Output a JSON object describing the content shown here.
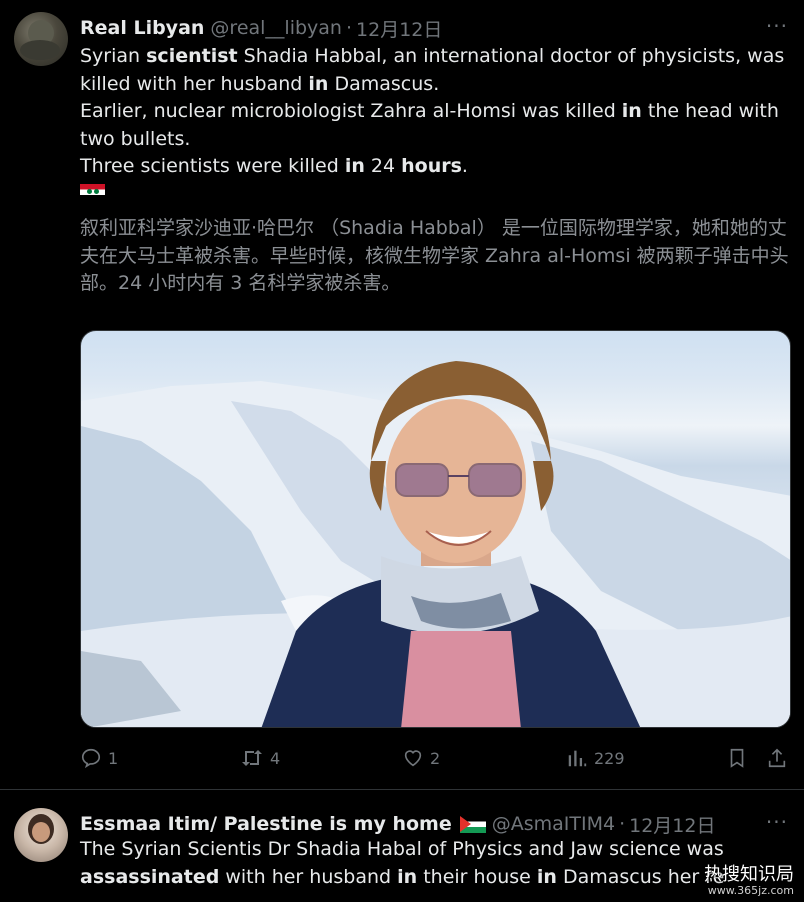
{
  "tweets": [
    {
      "name": "Real Libyan",
      "handle": "@real__libyan",
      "separator": "·",
      "date": "12月12日",
      "more": "···",
      "body_line1_parts": [
        "Syrian ",
        "scientist",
        " Shadia Habbal, an international doctor of physicists, was killed with her husband ",
        "in",
        " Damascus."
      ],
      "body_line2_parts": [
        "Earlier, nuclear microbiologist Zahra al-Homsi was killed ",
        "in",
        " the head with two bullets."
      ],
      "body_line3_parts": [
        "Three scientists were killed ",
        "in",
        " 24 ",
        "hours",
        "."
      ],
      "translation": "叙利亚科学家沙迪亚·哈巴尔 （Shadia Habbal） 是一位国际物理学家，她和她的丈夫在大马士革被杀害。早些时候，核微生物学家 Zahra al-Homsi 被两颗子弹击中头部。24 小时内有 3 名科学家被杀害。",
      "flag_icon": "syria-flag-icon",
      "actions": {
        "replies": "1",
        "retweets": "4",
        "likes": "2",
        "views": "229"
      }
    },
    {
      "name": "Essmaa Itim/ Palestine is my home",
      "flag_icon": "palestine-flag-icon",
      "handle": "@AsmaITIM4",
      "separator": "·",
      "date": "12月12日",
      "more": "···",
      "body_line1": "The Syrian Scientis Dr Shadia Habal  of Physics and Jaw science was",
      "body_line2_parts": [
        "assassinated",
        " with her husband ",
        "in",
        " their house ",
        "in",
        " Damascus her re"
      ]
    }
  ],
  "watermark": {
    "text": "热搜知识局",
    "site": "www.365jz.com"
  },
  "colors": {
    "background": "#000000",
    "text": "#e7e9ea",
    "muted": "#71767b",
    "divider": "#2f3336"
  }
}
